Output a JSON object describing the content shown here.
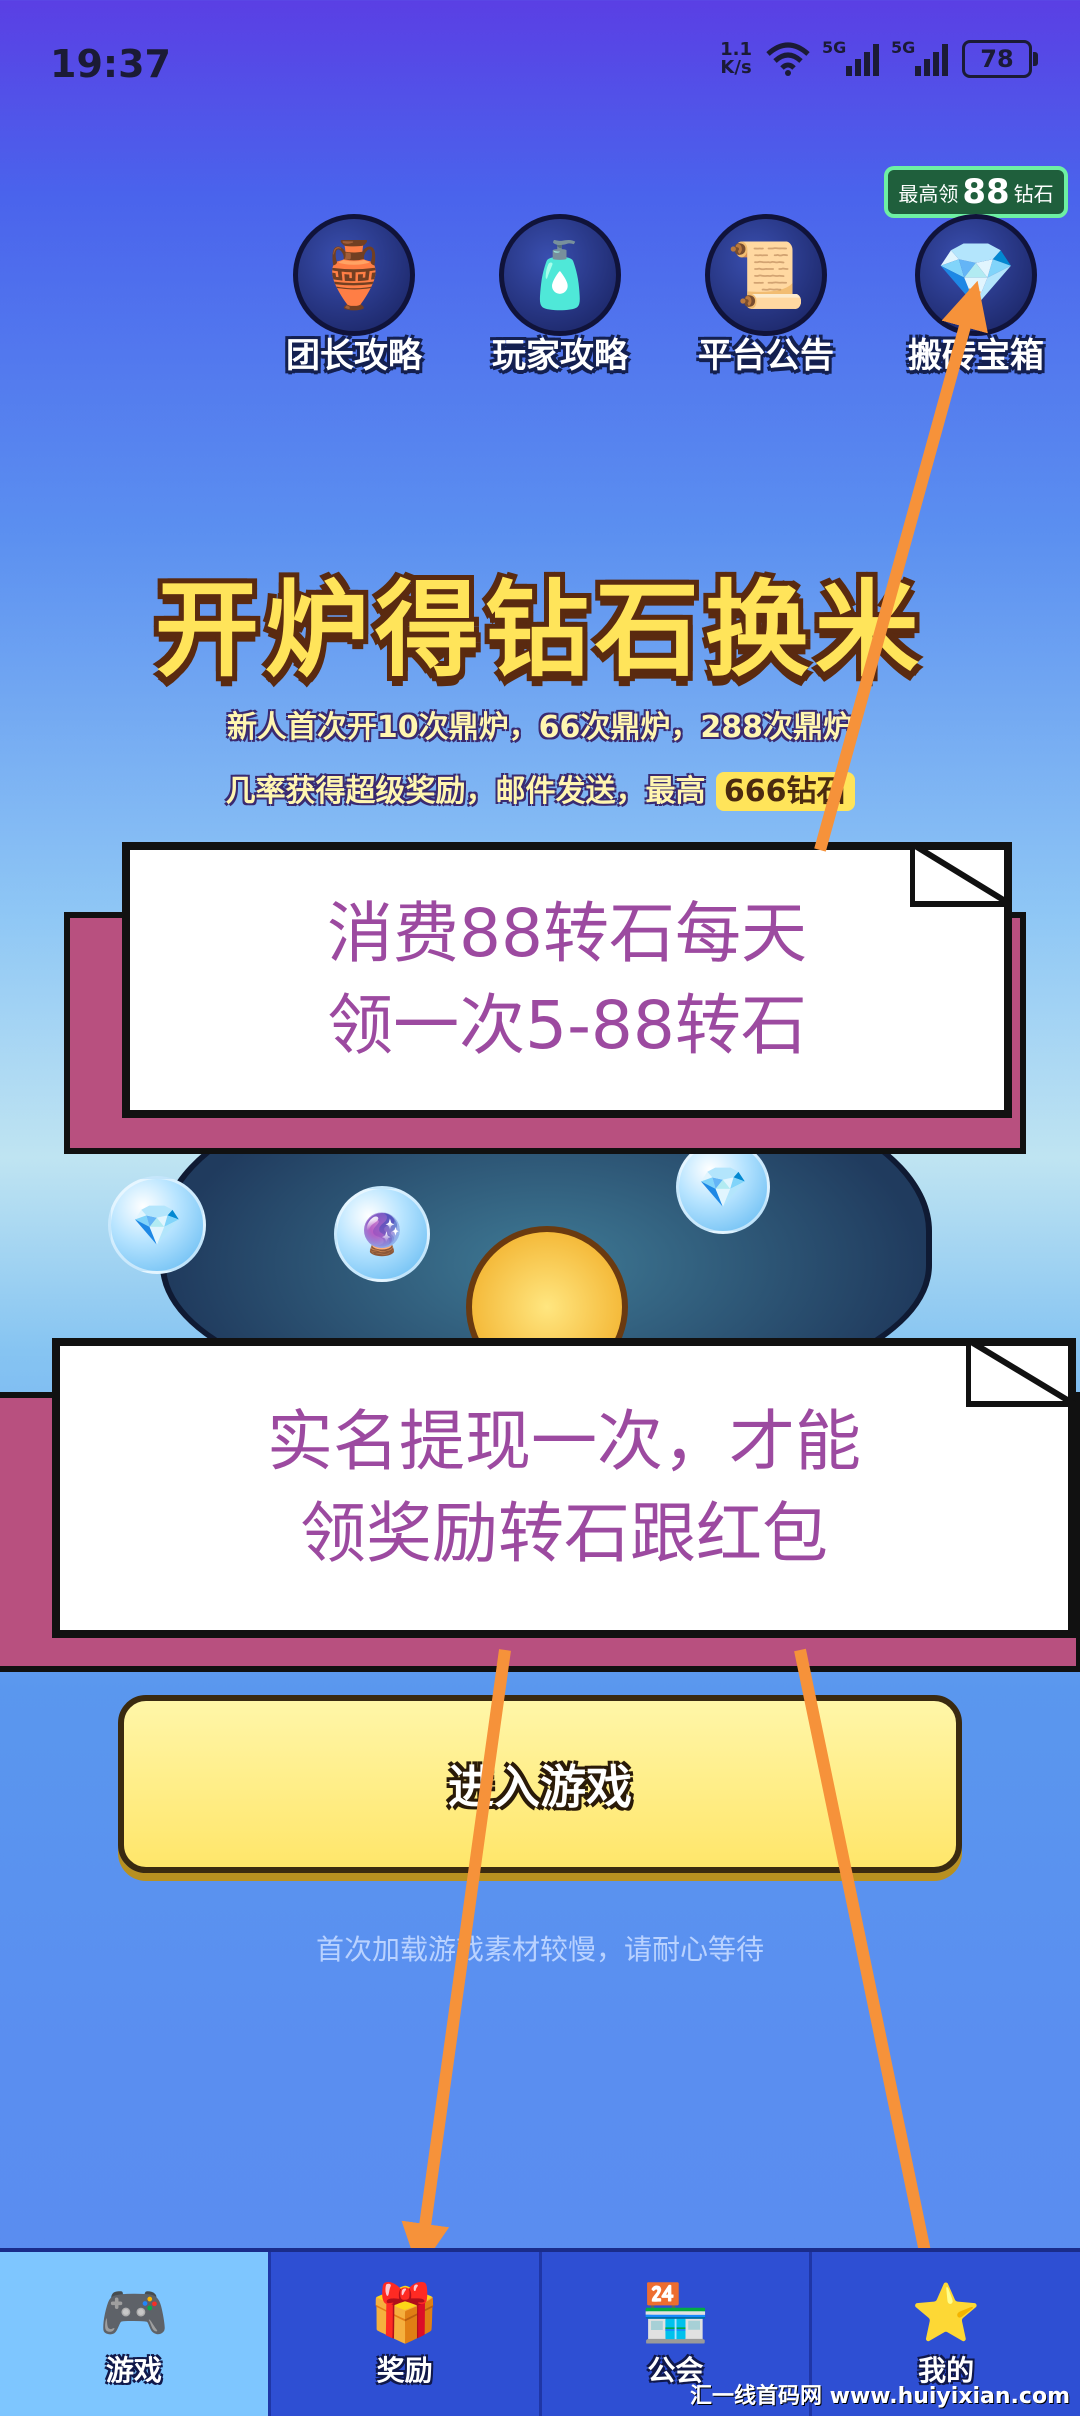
{
  "status_bar": {
    "time": "19:37",
    "net_speed_value": "1.1",
    "net_speed_unit": "K/s",
    "signal1_label": "5G",
    "signal2_label": "5G",
    "battery": "78"
  },
  "badge": {
    "prefix": "最高领",
    "number": "88",
    "suffix": "钻石"
  },
  "shortcuts": [
    {
      "label": "团长攻略",
      "icon": "gourd-icon"
    },
    {
      "label": "玩家攻略",
      "icon": "spray-icon"
    },
    {
      "label": "平台公告",
      "icon": "scroll-icon"
    },
    {
      "label": "搬砖宝箱",
      "icon": "treasure-chest-icon"
    }
  ],
  "hero": {
    "title": "开炉得钻石换米",
    "sub_line1": "新人首次开10次鼎炉，66次鼎炉，288次鼎炉",
    "sub_line2_prefix": "几率获得超级奖励，邮件发送，最高",
    "sub_line2_highlight": "666钻石"
  },
  "notes": [
    {
      "line1": "消费88转石每天",
      "line2": "领一次5-88转石"
    },
    {
      "line1": "实名提现一次，才能",
      "line2": "领奖励转石跟红包"
    }
  ],
  "enter_button": "进入游戏",
  "hint": "首次加载游戏素材较慢，请耐心等待",
  "nav": [
    {
      "label": "游戏",
      "icon": "gamepad-icon",
      "active": true
    },
    {
      "label": "奖励",
      "icon": "reward-chest-icon",
      "active": false
    },
    {
      "label": "公会",
      "icon": "guild-shop-icon",
      "active": false
    },
    {
      "label": "我的",
      "icon": "profile-icon",
      "active": false
    }
  ],
  "watermark": "汇一线首码网 www.huiyixian.com",
  "colors": {
    "arrow": "#f6923a",
    "note_text": "#9c4aa0",
    "note_back": "#b8507f",
    "nav_bg": "#2e4fd3",
    "nav_active": "#7ec6ff"
  }
}
